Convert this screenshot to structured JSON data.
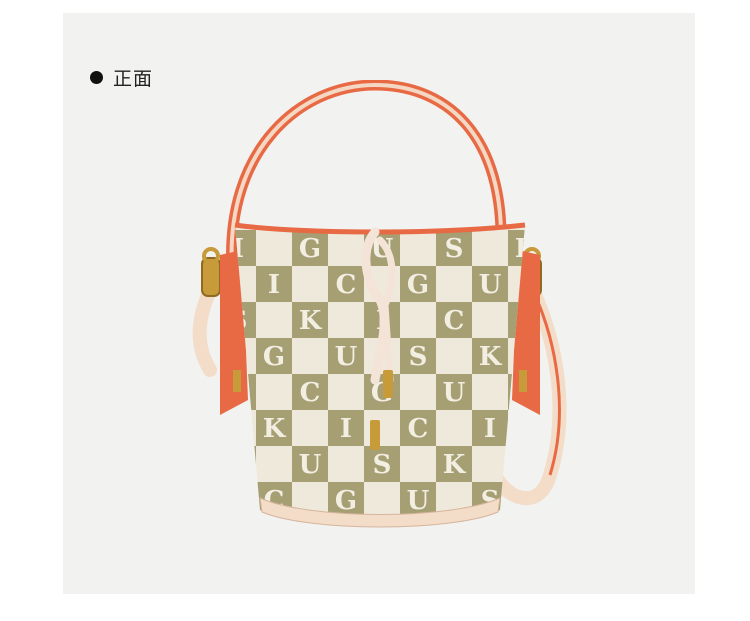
{
  "view_label": "正面",
  "product": {
    "pattern_letters": [
      "I",
      "G",
      "U",
      "S",
      "K",
      "I",
      "C",
      "G",
      "U",
      "S",
      "K",
      "I",
      "C",
      "I",
      "G",
      "U",
      "S",
      "K",
      "I",
      "C",
      "G",
      "U",
      "S",
      "K",
      "I",
      "C"
    ],
    "colors": {
      "panel_bg": "#f2f2f1",
      "leather_trim": "#e86a45",
      "canvas_light": "#efe9dc",
      "pattern_olive": "#a59f73",
      "hardware_gold": "#c79a3a",
      "strap_cream": "#f3dcc8"
    }
  }
}
